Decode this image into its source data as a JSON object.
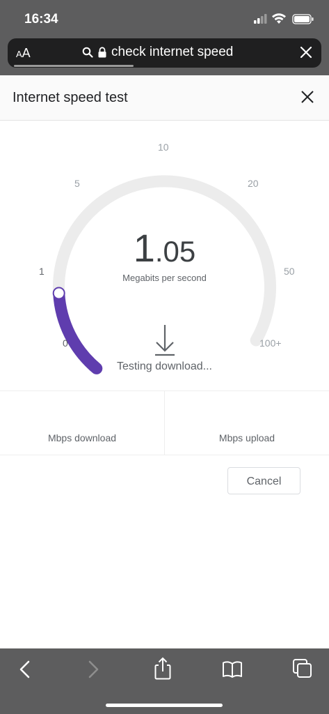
{
  "status": {
    "time": "16:34"
  },
  "browser": {
    "text_size_label_small": "A",
    "text_size_label_large": "A",
    "url_text": "check internet speed",
    "load_progress": 0.4
  },
  "speedtest": {
    "title": "Internet speed test",
    "speed_integer": "1",
    "speed_decimal": ".05",
    "speed_unit": "Megabits per second",
    "scale_ticks": [
      "0",
      "1",
      "5",
      "10",
      "20",
      "50",
      "100+"
    ],
    "gauge_fraction": 0.18,
    "status_text": "Testing download...",
    "download_label": "Mbps download",
    "upload_label": "Mbps upload",
    "cancel_label": "Cancel",
    "accent_color": "#5f3dae"
  },
  "toolbar": {
    "icons": [
      "back-icon",
      "forward-icon",
      "share-icon",
      "bookmarks-icon",
      "tabs-icon"
    ]
  }
}
